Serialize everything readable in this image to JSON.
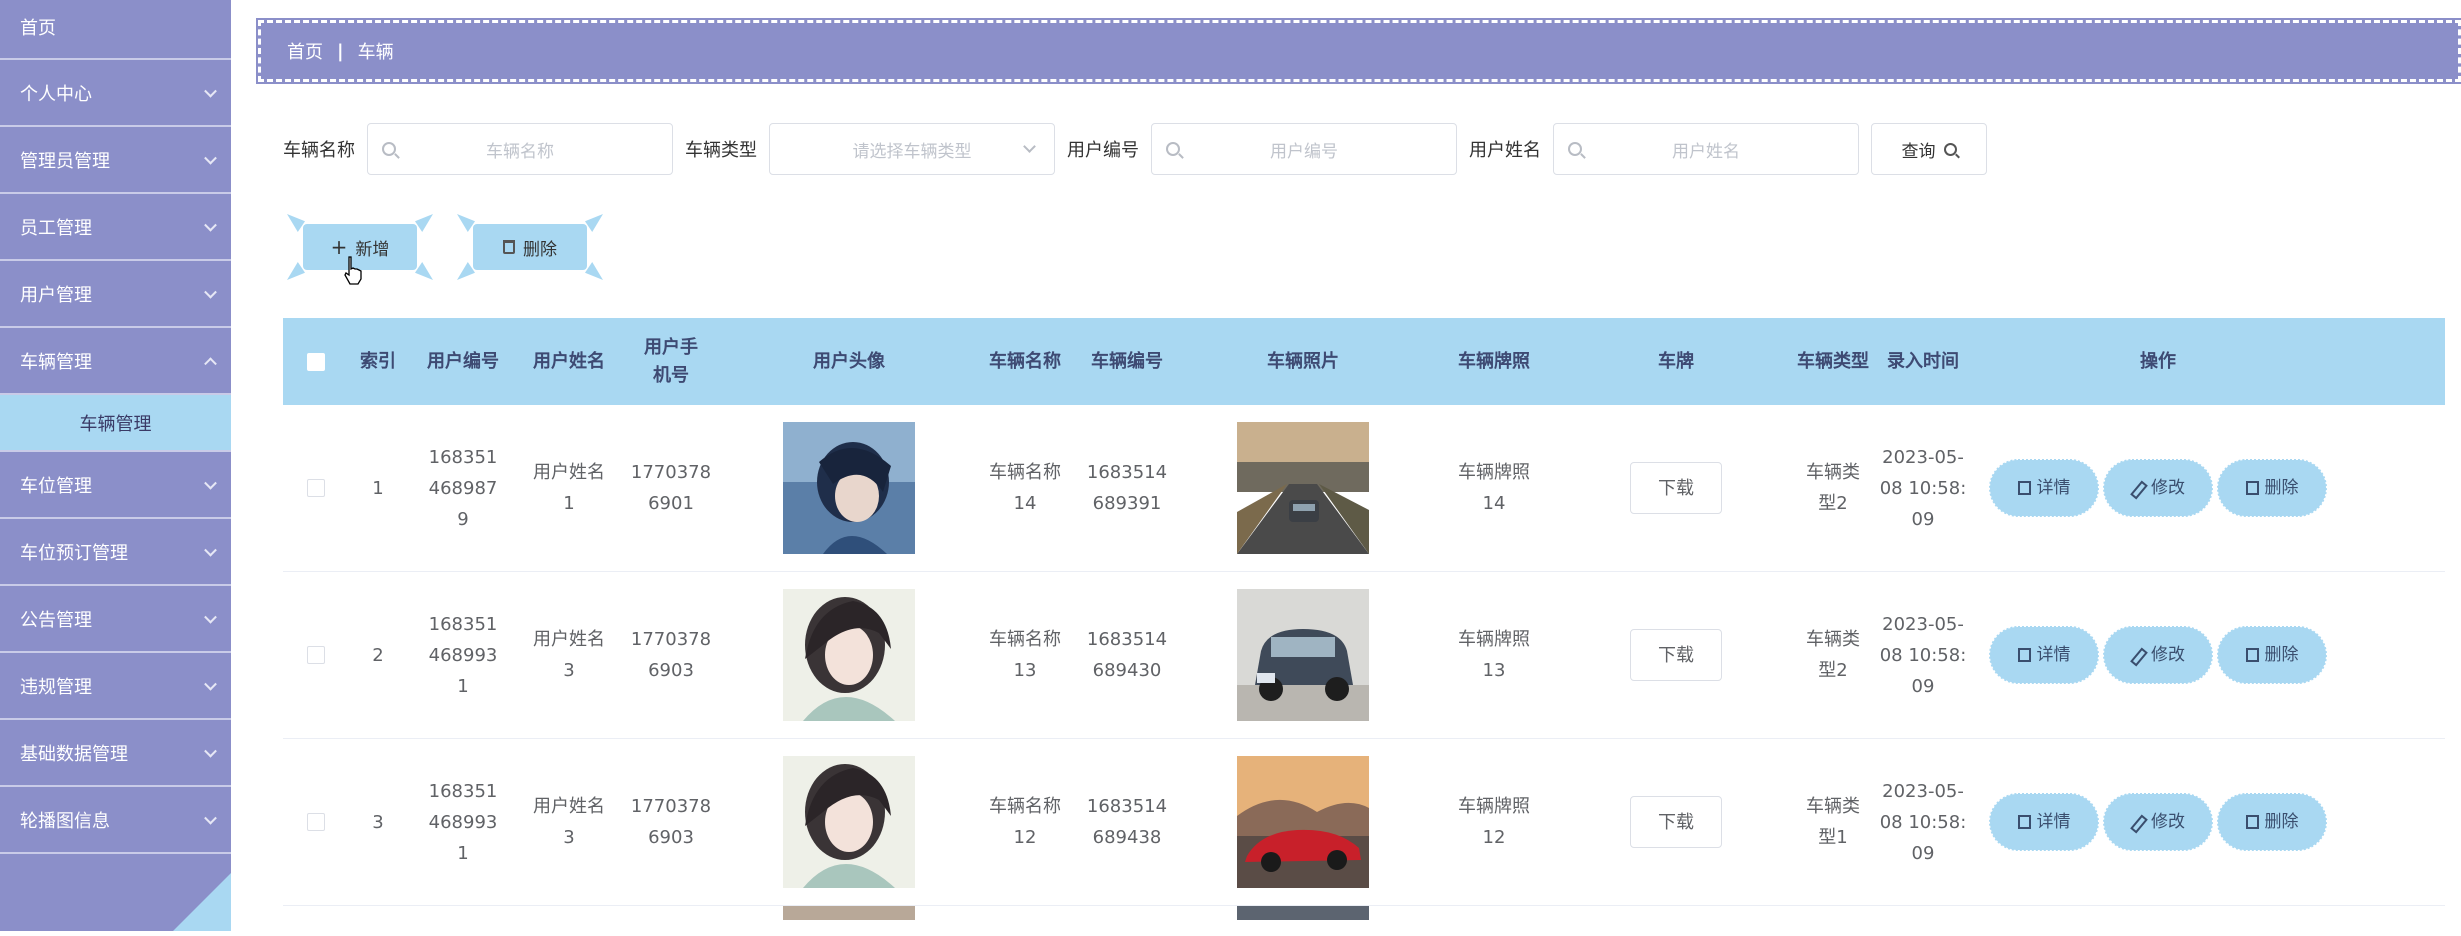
{
  "sidebar": {
    "items": [
      {
        "label": "首页"
      },
      {
        "label": "个人中心"
      },
      {
        "label": "管理员管理"
      },
      {
        "label": "员工管理"
      },
      {
        "label": "用户管理"
      },
      {
        "label": "车辆管理"
      },
      {
        "label": "车位管理"
      },
      {
        "label": "车位预订管理"
      },
      {
        "label": "公告管理"
      },
      {
        "label": "违规管理"
      },
      {
        "label": "基础数据管理"
      },
      {
        "label": "轮播图信息"
      }
    ],
    "active_sub": "车辆管理"
  },
  "breadcrumb": {
    "home": "首页",
    "sep": "|",
    "current": "车辆"
  },
  "search": {
    "name_label": "车辆名称",
    "name_placeholder": "车辆名称",
    "type_label": "车辆类型",
    "type_placeholder": "请选择车辆类型",
    "user_no_label": "用户编号",
    "user_no_placeholder": "用户编号",
    "user_name_label": "用户姓名",
    "user_name_placeholder": "用户姓名",
    "query_label": "查询"
  },
  "actions": {
    "add_label": "新增",
    "delete_label": "删除"
  },
  "table": {
    "headers": {
      "index": "索引",
      "user_no": "用户编号",
      "user_name": "用户姓名",
      "user_phone": "用户手机号",
      "avatar": "用户头像",
      "car_name": "车辆名称",
      "car_no": "车辆编号",
      "car_photo": "车辆照片",
      "car_license": "车辆牌照",
      "plate": "车牌",
      "car_type": "车辆类型",
      "created": "录入时间",
      "ops": "操作"
    },
    "rows": [
      {
        "index": "1",
        "user_no": "1683514689879",
        "user_name": "用户姓名1",
        "phone": "17703786901",
        "car_name": "车辆名称14",
        "car_no": "1683514689391",
        "license": "车辆牌照14",
        "download": "下载",
        "car_type": "车辆类型2",
        "created": "2023-05-08 10:58:09"
      },
      {
        "index": "2",
        "user_no": "1683514689931",
        "user_name": "用户姓名3",
        "phone": "17703786903",
        "car_name": "车辆名称13",
        "car_no": "1683514689430",
        "license": "车辆牌照13",
        "download": "下载",
        "car_type": "车辆类型2",
        "created": "2023-05-08 10:58:09"
      },
      {
        "index": "3",
        "user_no": "1683514689931",
        "user_name": "用户姓名3",
        "phone": "17703786903",
        "car_name": "车辆名称12",
        "car_no": "1683514689438",
        "license": "车辆牌照12",
        "download": "下载",
        "car_type": "车辆类型1",
        "created": "2023-05-08 10:58:09"
      }
    ],
    "op_labels": {
      "detail": "详情",
      "edit": "修改",
      "delete": "删除"
    }
  },
  "colors": {
    "sidebar": "#8b8fc9",
    "accent": "#a9d8f2",
    "header_text": "#3e4a73"
  }
}
